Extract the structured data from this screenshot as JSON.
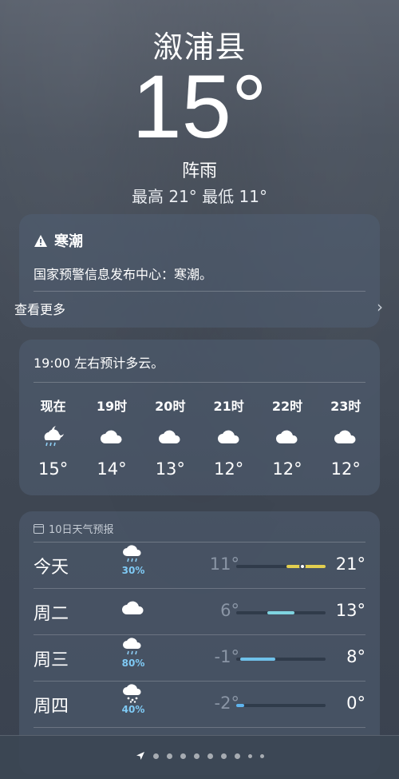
{
  "header": {
    "city": "溆浦县",
    "temperature": "15°",
    "condition": "阵雨",
    "hilo": "最高 21°  最低 11°"
  },
  "alert": {
    "title": "寒潮",
    "text": "国家预警信息发布中心：寒潮。",
    "more_label": "查看更多",
    "icon": "warning-triangle-icon"
  },
  "hourly": {
    "summary": "19:00 左右预计多云。",
    "hours": [
      {
        "label": "现在",
        "icon": "night-rain-cloud-icon",
        "temp": "15°"
      },
      {
        "label": "19时",
        "icon": "cloud-icon",
        "temp": "14°"
      },
      {
        "label": "20时",
        "icon": "cloud-icon",
        "temp": "13°"
      },
      {
        "label": "21时",
        "icon": "cloud-icon",
        "temp": "12°"
      },
      {
        "label": "22时",
        "icon": "cloud-icon",
        "temp": "12°"
      },
      {
        "label": "23时",
        "icon": "cloud-icon",
        "temp": "12°"
      }
    ]
  },
  "daily": {
    "heading": "10日天气预报",
    "range": [
      -2,
      21
    ],
    "days": [
      {
        "day": "今天",
        "icon": "rain-cloud-icon",
        "prob": "30%",
        "low": "11°",
        "high": "21°",
        "low_val": 11,
        "high_val": 21,
        "color": "#e3cf4f",
        "current": 15
      },
      {
        "day": "周二",
        "icon": "cloud-icon",
        "prob": "",
        "low": "6°",
        "high": "13°",
        "low_val": 6,
        "high_val": 13,
        "color": "#7fd3e0"
      },
      {
        "day": "周三",
        "icon": "rain-cloud-icon",
        "prob": "80%",
        "low": "-1°",
        "high": "8°",
        "low_val": -1,
        "high_val": 8,
        "color": "#6fc1ea"
      },
      {
        "day": "周四",
        "icon": "snow-cloud-icon",
        "prob": "40%",
        "low": "-2°",
        "high": "0°",
        "low_val": -2,
        "high_val": 0,
        "color": "#5fb4ee"
      }
    ]
  },
  "pager": {
    "pages": 8
  }
}
